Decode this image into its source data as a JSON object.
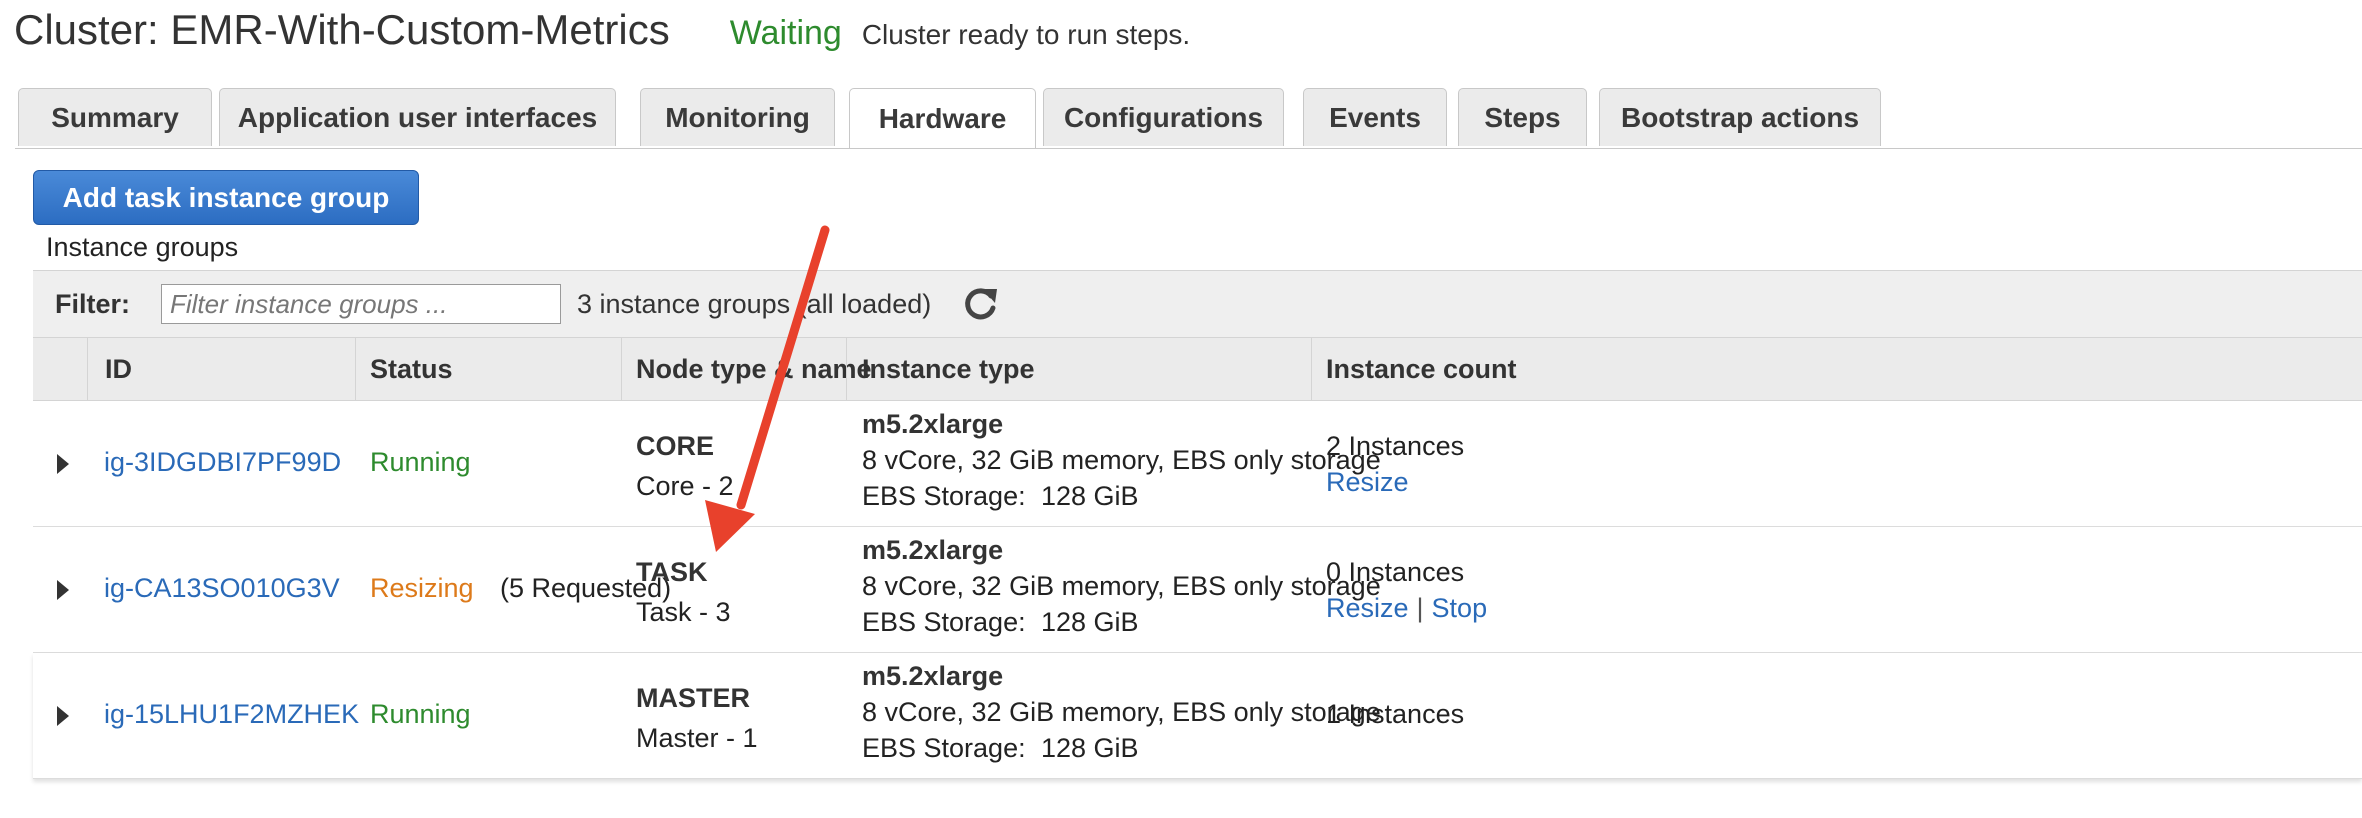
{
  "header": {
    "title": "Cluster: EMR-With-Custom-Metrics",
    "state": "Waiting",
    "message": "Cluster ready to run steps."
  },
  "tabs": [
    {
      "label": "Summary"
    },
    {
      "label": "Application user interfaces"
    },
    {
      "label": "Monitoring"
    },
    {
      "label": "Hardware",
      "active": true
    },
    {
      "label": "Configurations"
    },
    {
      "label": "Events"
    },
    {
      "label": "Steps"
    },
    {
      "label": "Bootstrap actions"
    }
  ],
  "toolbar": {
    "add_task_label": "Add task instance group",
    "section_label": "Instance groups"
  },
  "filter": {
    "label": "Filter:",
    "placeholder": "Filter instance groups ...",
    "count": "3 instance groups (all loaded)"
  },
  "table": {
    "columns": [
      "ID",
      "Status",
      "Node type & name",
      "Instance type",
      "Instance count"
    ],
    "rows": [
      {
        "id": "ig-3IDGDBI7PF99D",
        "status": "Running",
        "status_extra": "",
        "node_type": "CORE",
        "node_name": "Core - 2",
        "instance_type": "m5.2xlarge",
        "instance_spec": "8 vCore, 32 GiB memory, EBS only storage",
        "ebs_label": "EBS Storage:",
        "ebs_value": "128 GiB",
        "count": "2 Instances",
        "actions": [
          "Resize"
        ]
      },
      {
        "id": "ig-CA13SO010G3V",
        "status": "Resizing",
        "status_extra": "(5 Requested)",
        "node_type": "TASK",
        "node_name": "Task - 3",
        "instance_type": "m5.2xlarge",
        "instance_spec": "8 vCore, 32 GiB memory, EBS only storage",
        "ebs_label": "EBS Storage:",
        "ebs_value": "128 GiB",
        "count": "0 Instances",
        "actions": [
          "Resize",
          "Stop"
        ]
      },
      {
        "id": "ig-15LHU1F2MZHEK",
        "status": "Running",
        "status_extra": "",
        "node_type": "MASTER",
        "node_name": "Master - 1",
        "instance_type": "m5.2xlarge",
        "instance_spec": "8 vCore, 32 GiB memory, EBS only storage",
        "ebs_label": "EBS Storage:",
        "ebs_value": "128 GiB",
        "count": "1 Instances",
        "actions": []
      }
    ]
  },
  "colors": {
    "running": "#2e8b2e",
    "resizing": "#dd7a1a",
    "link": "#2a6ab8",
    "primary_button": "#2c6dc2",
    "annotation_arrow": "#e8412c"
  },
  "icons": {
    "refresh": "refresh-icon",
    "expander": "caret-right-icon",
    "annotation": "red-arrow"
  }
}
